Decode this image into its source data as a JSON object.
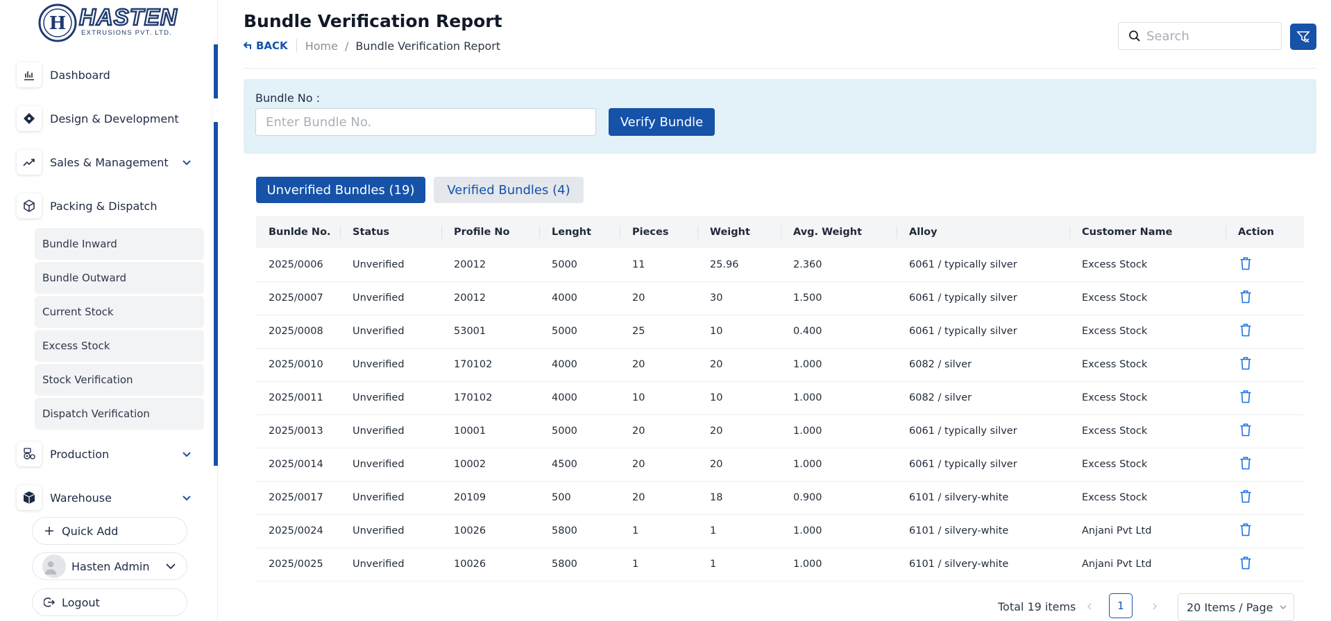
{
  "brand": {
    "name": "HASTEN",
    "tagline": "EXTRUSIONS PVT. LTD.",
    "monogram": "H",
    "color": "#1552a8"
  },
  "sidebar": {
    "items": [
      {
        "label": "Dashboard",
        "icon": "bar-chart-icon"
      },
      {
        "label": "Design & Development",
        "icon": "pen-tool-icon"
      },
      {
        "label": "Sales & Management",
        "icon": "trend-up-icon",
        "expandable": true
      },
      {
        "label": "Packing & Dispatch",
        "icon": "package-icon",
        "expanded": true
      },
      {
        "label": "Production",
        "icon": "gears-icon",
        "expandable": true
      },
      {
        "label": "Warehouse",
        "icon": "warehouse-box-icon",
        "expandable": true
      }
    ],
    "subitems": [
      {
        "label": "Bundle Inward"
      },
      {
        "label": "Bundle Outward"
      },
      {
        "label": "Current Stock"
      },
      {
        "label": "Excess Stock"
      },
      {
        "label": "Stock Verification"
      },
      {
        "label": "Dispatch Verification"
      }
    ],
    "quick_add": "Quick Add",
    "user_name": "Hasten Admin",
    "logout": "Logout"
  },
  "header": {
    "title": "Bundle Verification Report",
    "back": "BACK",
    "breadcrumb": [
      "Home",
      "Bundle Verification Report"
    ],
    "search_placeholder": "Search"
  },
  "verify": {
    "label": "Bundle No :",
    "placeholder": "Enter Bundle No.",
    "button": "Verify Bundle"
  },
  "tabs": [
    {
      "label": "Unverified Bundles (19)",
      "active": true
    },
    {
      "label": "Verified Bundles (4)",
      "active": false
    }
  ],
  "table": {
    "columns": [
      "Bunlde No.",
      "Status",
      "Profile No",
      "Lenght",
      "Pieces",
      "Weight",
      "Avg. Weight",
      "Alloy",
      "Customer Name",
      "Action"
    ],
    "rows": [
      [
        "2025/0006",
        "Unverified",
        "20012",
        "5000",
        "11",
        "25.96",
        "2.360",
        "6061 / typically silver",
        "Excess Stock"
      ],
      [
        "2025/0007",
        "Unverified",
        "20012",
        "4000",
        "20",
        "30",
        "1.500",
        "6061 / typically silver",
        "Excess Stock"
      ],
      [
        "2025/0008",
        "Unverified",
        "53001",
        "5000",
        "25",
        "10",
        "0.400",
        "6061 / typically silver",
        "Excess Stock"
      ],
      [
        "2025/0010",
        "Unverified",
        "170102",
        "4000",
        "20",
        "20",
        "1.000",
        "6082 / silver",
        "Excess Stock"
      ],
      [
        "2025/0011",
        "Unverified",
        "170102",
        "4000",
        "10",
        "10",
        "1.000",
        "6082 / silver",
        "Excess Stock"
      ],
      [
        "2025/0013",
        "Unverified",
        "10001",
        "5000",
        "20",
        "20",
        "1.000",
        "6061 / typically silver",
        "Excess Stock"
      ],
      [
        "2025/0014",
        "Unverified",
        "10002",
        "4500",
        "20",
        "20",
        "1.000",
        "6061 / typically silver",
        "Excess Stock"
      ],
      [
        "2025/0017",
        "Unverified",
        "20109",
        "500",
        "20",
        "18",
        "0.900",
        "6101 / silvery-white",
        "Excess Stock"
      ],
      [
        "2025/0024",
        "Unverified",
        "10026",
        "5800",
        "1",
        "1",
        "1.000",
        "6101 / silvery-white",
        "Anjani Pvt Ltd"
      ],
      [
        "2025/0025",
        "Unverified",
        "10026",
        "5800",
        "1",
        "1",
        "1.000",
        "6101 / silvery-white",
        "Anjani Pvt Ltd"
      ]
    ],
    "action_icon": "trash-icon"
  },
  "pagination": {
    "total": "Total 19 items",
    "current_page": "1",
    "page_size": "20 Items / Page"
  }
}
